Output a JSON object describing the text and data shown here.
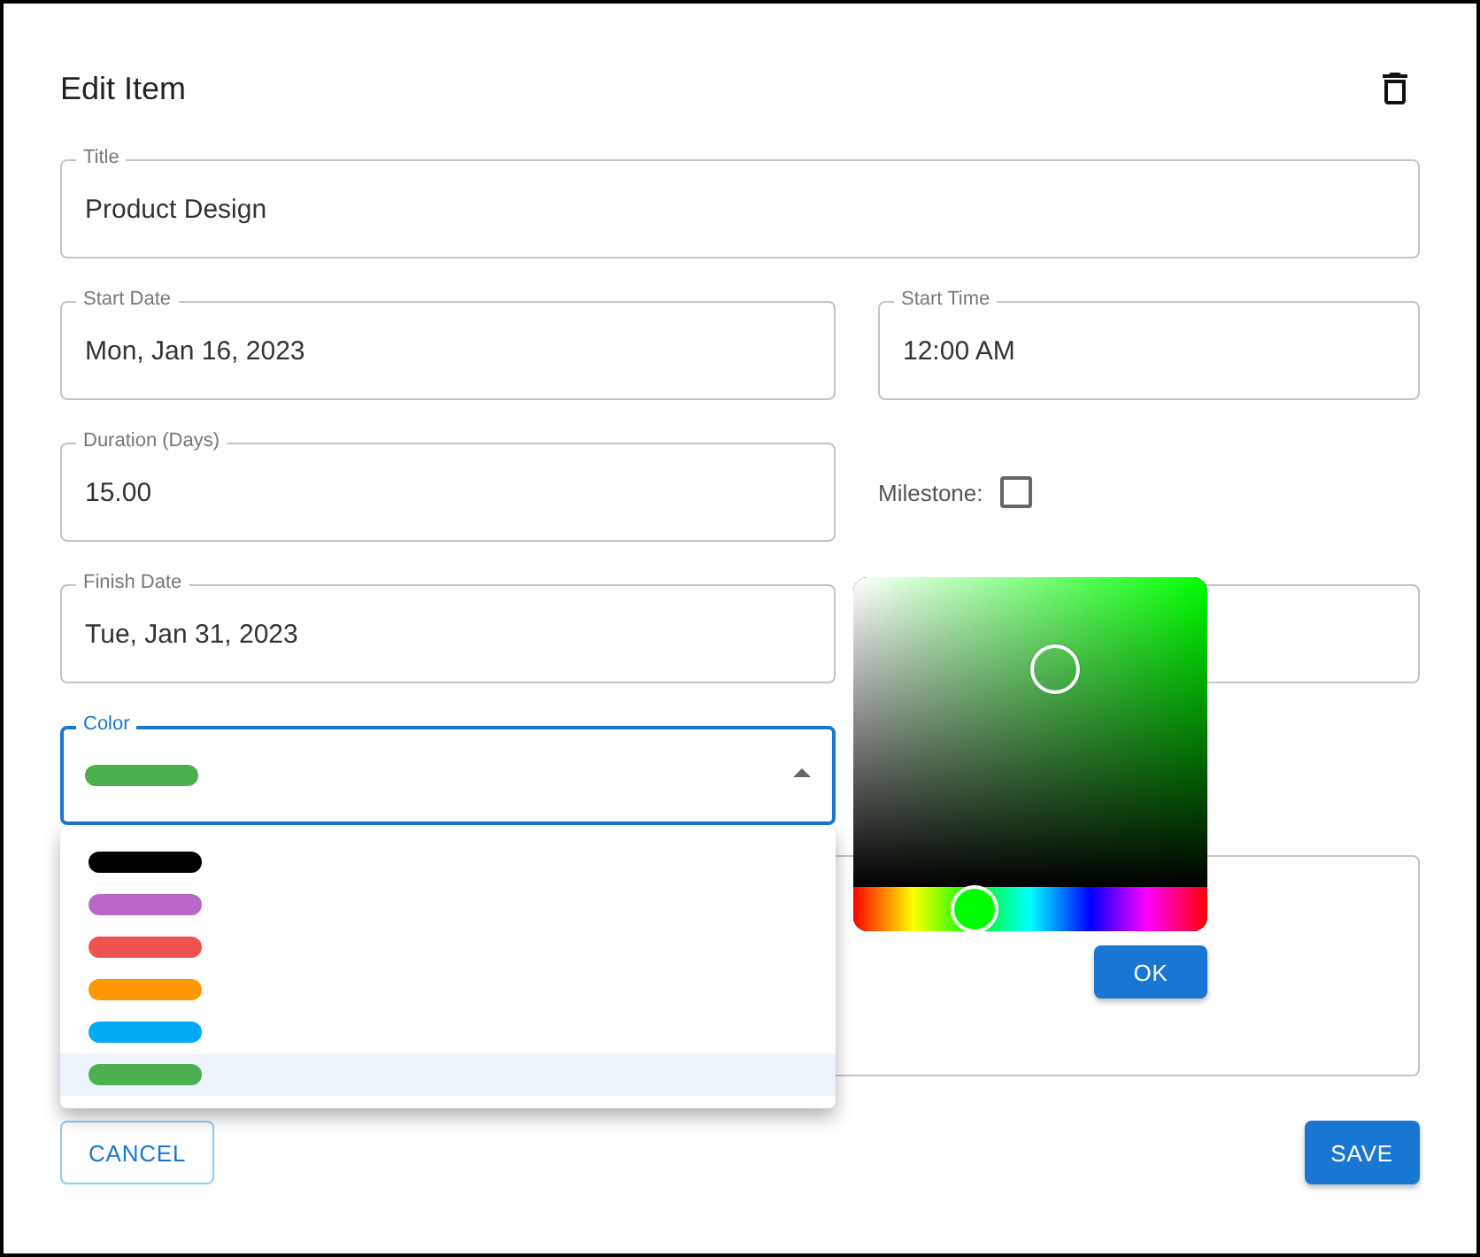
{
  "dialog": {
    "title": "Edit Item"
  },
  "rows": [
    [
      {
        "kind": "text",
        "label": "Title",
        "value": "Product Design"
      }
    ],
    [
      {
        "kind": "text",
        "label": "Start Date",
        "value": "Mon, Jan 16, 2023"
      },
      {
        "kind": "text",
        "label": "Start Time",
        "value": "12:00 AM"
      }
    ],
    [
      {
        "kind": "text",
        "label": "Duration (Days)",
        "value": "15.00"
      },
      {
        "kind": "checkbox",
        "label": "Milestone:",
        "checked": false
      }
    ],
    [
      {
        "kind": "text",
        "label": "Finish Date",
        "value": "Tue, Jan 31, 2023"
      },
      {
        "kind": "blank"
      }
    ],
    [
      {
        "kind": "select",
        "label": "Color",
        "color": "#4caf50",
        "focused": true
      }
    ],
    [
      {
        "kind": "area"
      }
    ]
  ],
  "color_menu": [
    {
      "color": "#000000",
      "selected": false
    },
    {
      "color": "#ba68c8",
      "selected": false
    },
    {
      "color": "#ef5350",
      "selected": false
    },
    {
      "color": "#ff9800",
      "selected": false
    },
    {
      "color": "#03a9f4",
      "selected": false
    },
    {
      "color": "#4caf50",
      "selected": true
    }
  ],
  "color_picker": {
    "hue": {
      "level": 0.34
    },
    "ok": "OK"
  },
  "buttons": {
    "cancel": "CANCEL",
    "save": "SAVE"
  }
}
